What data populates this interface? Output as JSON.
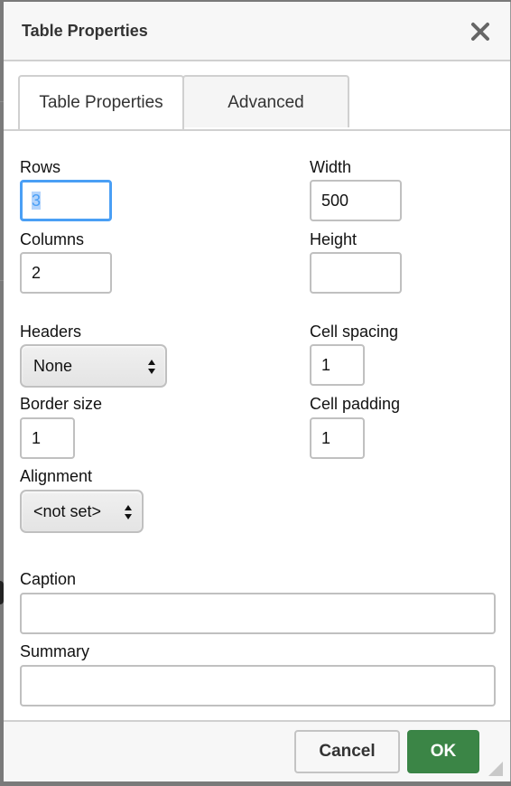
{
  "dialog": {
    "title": "Table Properties",
    "close_icon": "close-icon"
  },
  "tabs": [
    {
      "label": "Table Properties",
      "active": true
    },
    {
      "label": "Advanced",
      "active": false
    }
  ],
  "fields": {
    "rows": {
      "label": "Rows",
      "value": "3",
      "focused": true,
      "text_selected": true
    },
    "columns": {
      "label": "Columns",
      "value": "2"
    },
    "width": {
      "label": "Width",
      "value": "500"
    },
    "height": {
      "label": "Height",
      "value": ""
    },
    "headers": {
      "label": "Headers",
      "selected": "None"
    },
    "cell_spacing": {
      "label": "Cell spacing",
      "value": "1"
    },
    "border_size": {
      "label": "Border size",
      "value": "1"
    },
    "cell_padding": {
      "label": "Cell padding",
      "value": "1"
    },
    "alignment": {
      "label": "Alignment",
      "selected": "<not set>"
    },
    "caption": {
      "label": "Caption",
      "value": ""
    },
    "summary": {
      "label": "Summary",
      "value": ""
    }
  },
  "footer": {
    "cancel_label": "Cancel",
    "ok_label": "OK"
  },
  "colors": {
    "ok_button": "#3b8546",
    "focus_ring": "#4a9ff5",
    "header_bg": "#f7f7f7"
  }
}
